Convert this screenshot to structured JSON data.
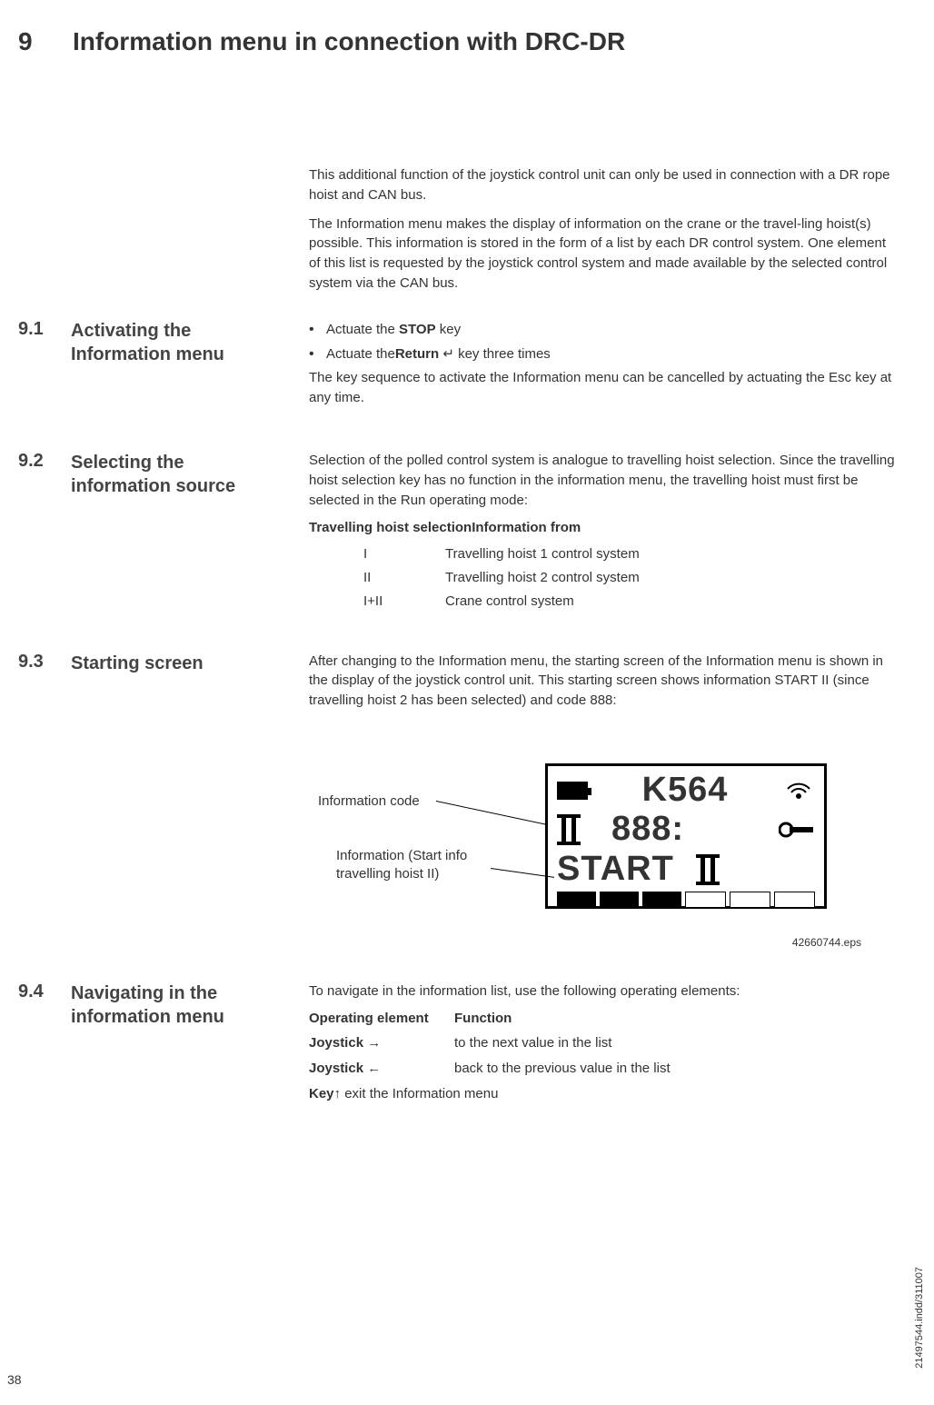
{
  "heading": {
    "num": "9",
    "title": "Information menu in connection with DRC-DR"
  },
  "intro": {
    "p1": "This additional function of the joystick control unit can only be used in connection with a DR rope hoist and CAN bus.",
    "p2": "The Information menu makes the display of information on the crane or the travel-ling hoist(s) possible. This information is stored in the form of a list by each DR control system. One element of this list is requested by the joystick control system and made available by the selected control system via the CAN bus."
  },
  "s91": {
    "num": "9.1",
    "title": "Activating the Information menu",
    "li1a": "Actuate the ",
    "li1b": "STOP",
    "li1c": " key",
    "li2a": "Actuate the",
    "li2b": "Return",
    "li2c": " ↵ key three times",
    "p": "The key sequence to activate the Information menu can be cancelled by actuating the Esc key at any time."
  },
  "s92": {
    "num": "9.2",
    "title": "Selecting the information source",
    "p": "Selection of the polled control system is analogue to travelling hoist selection. Since the travelling hoist selection key has no function in the information menu, the travelling hoist must first be selected in the Run operating mode:",
    "th1": "Travelling hoist selection",
    "th2": "Information from",
    "rows": [
      {
        "a": "I",
        "b": "Travelling hoist 1 control system"
      },
      {
        "a": "II",
        "b": "Travelling hoist 2 control system"
      },
      {
        "a": "I+II",
        "b": "Crane control system"
      }
    ]
  },
  "s93": {
    "num": "9.3",
    "title": "Starting screen",
    "p": "After changing to the Information menu, the starting screen of the Information menu is shown in the display of the joystick control unit. This starting screen shows information START II (since travelling hoist 2 has been selected) and code 888:",
    "callout1": "Information code",
    "callout2": "Information (Start info travelling hoist II)",
    "lcd": {
      "l1": "K564",
      "l2": "888:",
      "l3": "START"
    },
    "eps": "42660744.eps"
  },
  "s94": {
    "num": "9.4",
    "title": "Navigating in the information menu",
    "p": "To navigate in the information list, use the following operating elements:",
    "th1": "Operating element",
    "th2": "Function",
    "rows": [
      {
        "a": "Joystick",
        "arrow": "→",
        "b": "to the next value in the list"
      },
      {
        "a": "Joystick",
        "arrow": "←",
        "b": "back to the previous value in the list"
      },
      {
        "a": "Key",
        "arrow": "↑",
        "b": "exit the Information menu"
      }
    ]
  },
  "footer": {
    "pagenum": "38",
    "side": "21497544.indd/311007"
  }
}
